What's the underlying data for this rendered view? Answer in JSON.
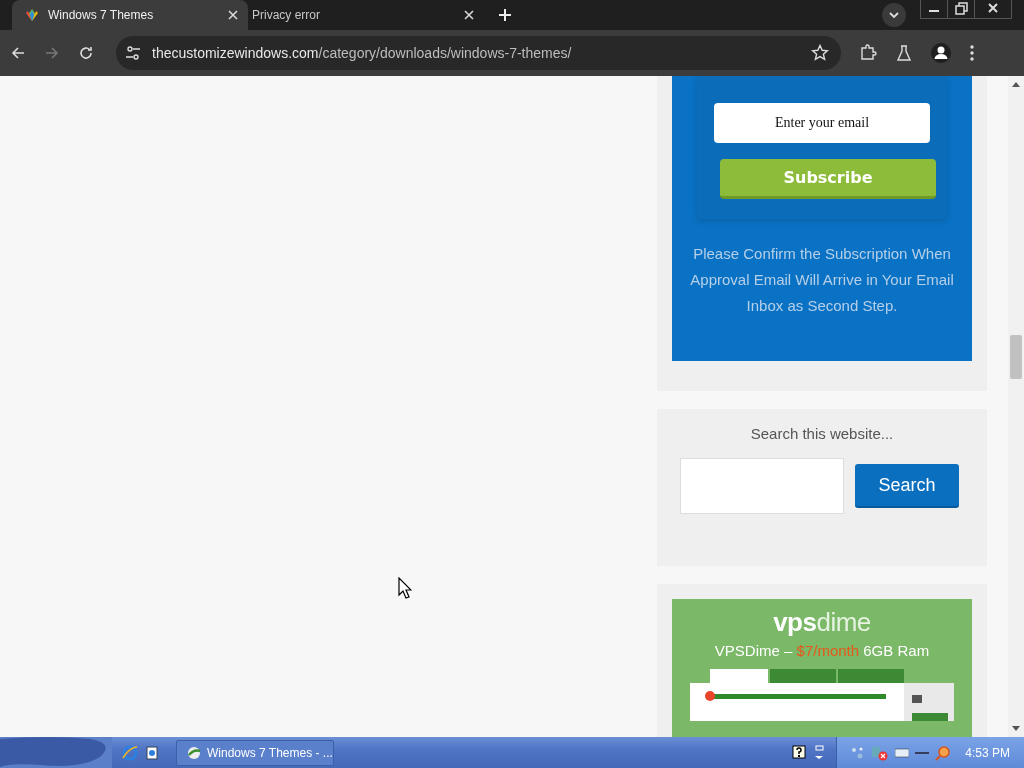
{
  "tabs": [
    {
      "title": "Windows 7 Themes",
      "selected": true
    },
    {
      "title": "Privacy error",
      "selected": false
    }
  ],
  "address_bar": {
    "host": "thecustomizewindows.com",
    "path": "/category/downloads/windows-7-themes/"
  },
  "subscribe": {
    "email_placeholder": "Enter your email",
    "button": "Subscribe",
    "note": "Please Confirm the Subscription When Approval Email Will Arrive in Your Email Inbox as Second Step."
  },
  "search_widget": {
    "title": "Search this website...",
    "button": "Search"
  },
  "ad": {
    "logo_start": "vps",
    "logo_end": "dime",
    "headline_start": "VPSDime –",
    "headline_price": "$7/month",
    "headline_end": "6GB Ram"
  },
  "taskbar": {
    "window_button": "Windows 7 Themes - ...",
    "clock": "4:53 PM"
  }
}
